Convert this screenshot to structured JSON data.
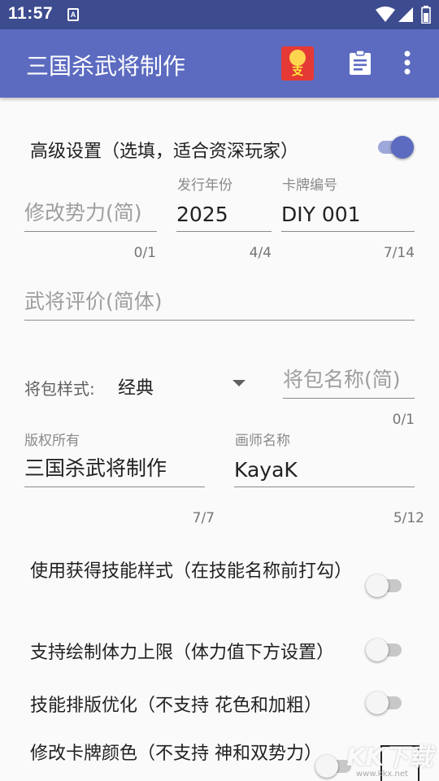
{
  "status_bar": {
    "time": "11:57",
    "notif_letter": "A"
  },
  "app_bar": {
    "title": "三国杀武将制作",
    "red_packet_char": "支",
    "icons": [
      "red-packet-icon",
      "clipboard-icon",
      "more-vert-icon"
    ]
  },
  "advanced": {
    "label": "高级设置（选填，适合资深玩家）",
    "enabled": true
  },
  "faction": {
    "placeholder": "修改势力(简)",
    "value": "",
    "counter": "0/1"
  },
  "year": {
    "label": "发行年份",
    "value": "2025",
    "counter": "4/4"
  },
  "card_no": {
    "label": "卡牌编号",
    "value": "DIY 001",
    "counter": "7/14"
  },
  "evaluation": {
    "placeholder": "武将评价(简体)",
    "value": ""
  },
  "pack": {
    "style_label": "将包样式:",
    "style_value": "经典",
    "name_placeholder": "将包名称(简)",
    "name_counter": "0/1"
  },
  "copyright": {
    "label": "版权所有",
    "value": "三国杀武将制作",
    "counter": "7/7"
  },
  "artist": {
    "label": "画师名称",
    "value": "KayaK",
    "counter": "5/12"
  },
  "toggles": [
    {
      "label": "使用获得技能样式（在技能名称前打勾）",
      "enabled": false
    },
    {
      "label": "支持绘制体力上限（体力值下方设置）",
      "enabled": false
    },
    {
      "label": "技能排版优化（不支持 花色和加粗）",
      "enabled": false
    },
    {
      "label": "修改卡牌颜色（不支持 神和双势力）",
      "enabled": false
    }
  ],
  "watermark": {
    "text": "KK下载",
    "url": "www.kkx.net"
  },
  "colors": {
    "status_bar": "#3d4b8f",
    "app_bar": "#5c6bc0",
    "switch_on": "#5c6bc0"
  }
}
